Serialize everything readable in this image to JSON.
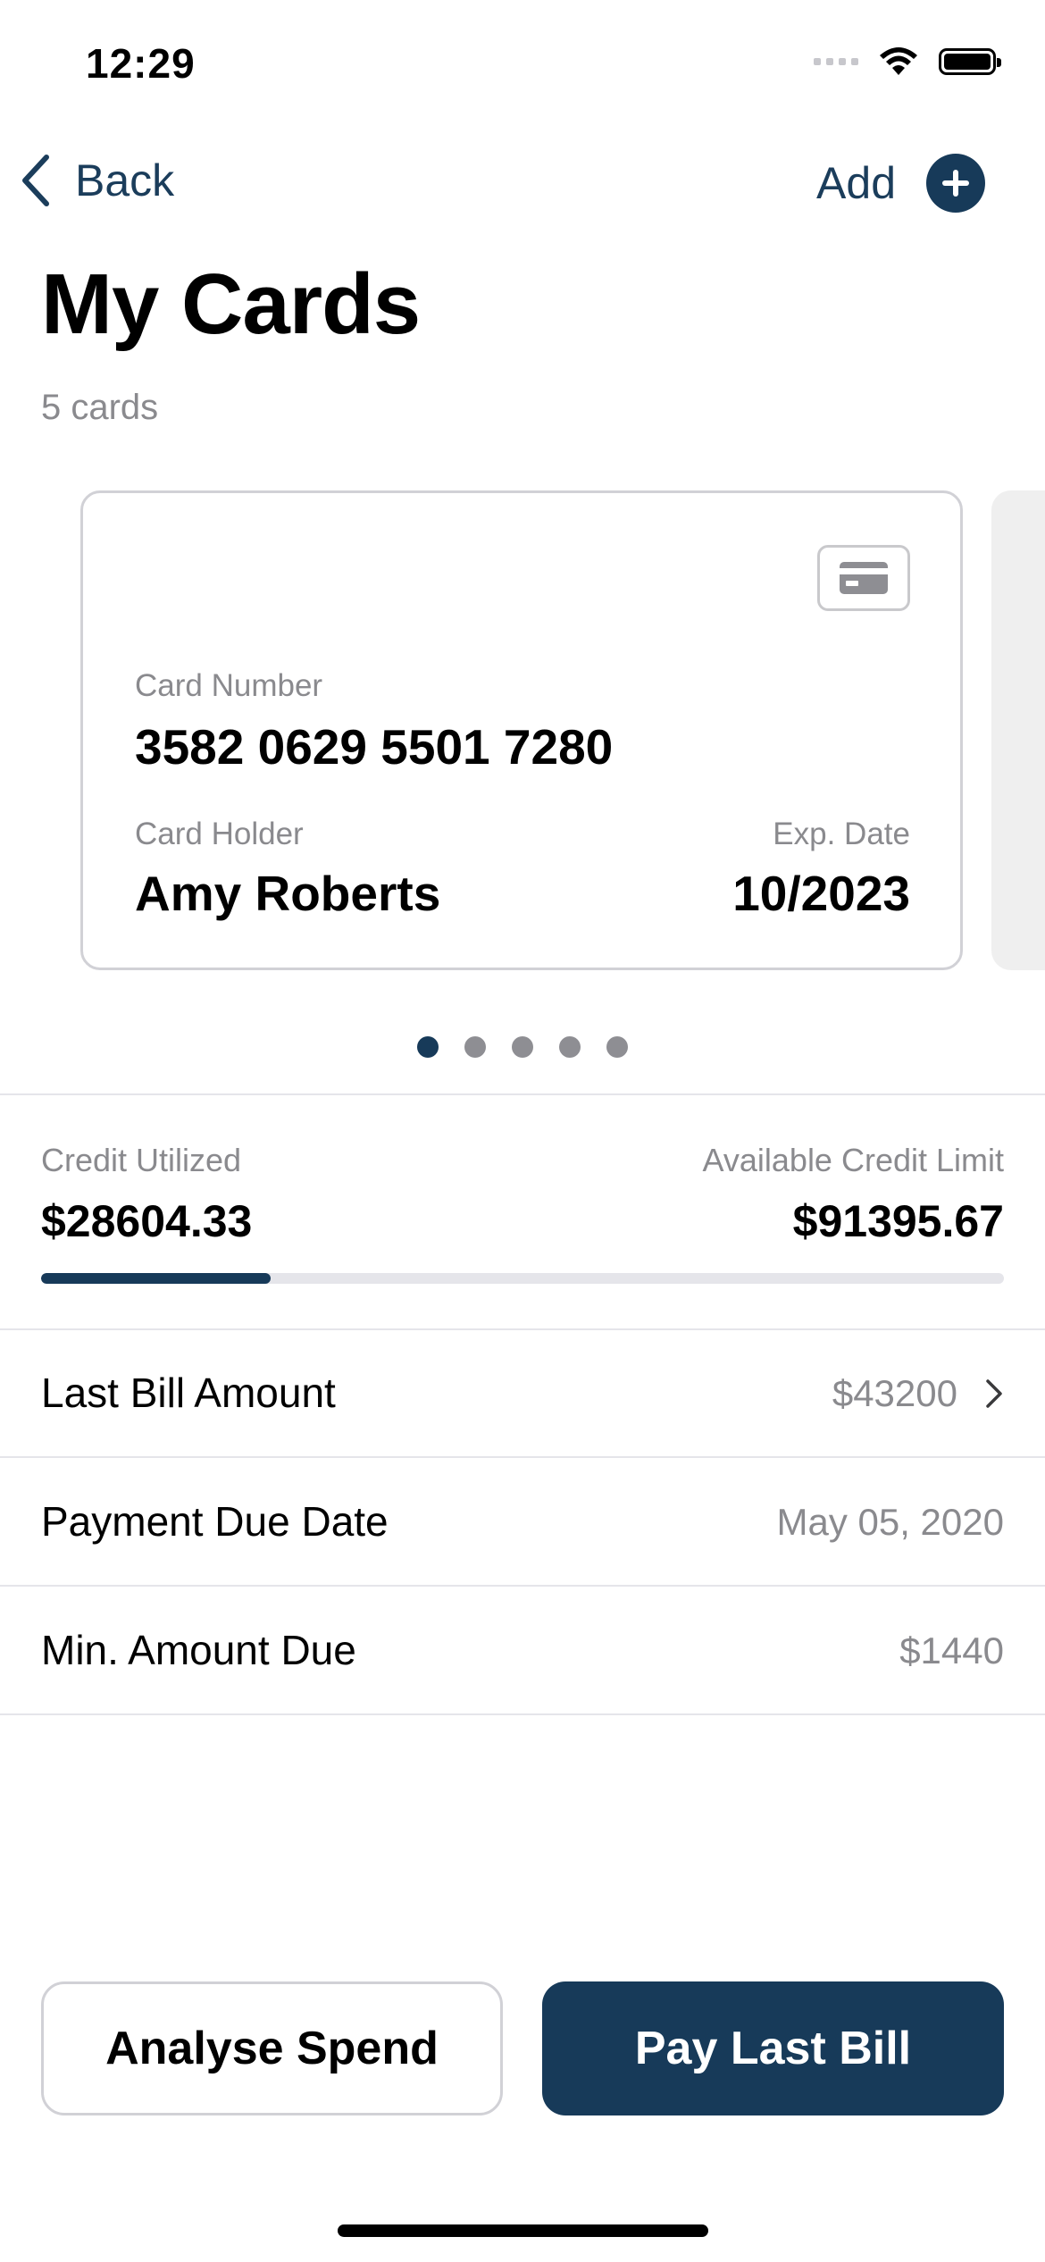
{
  "status_bar": {
    "time": "12:29"
  },
  "nav": {
    "back_label": "Back",
    "add_label": "Add"
  },
  "header": {
    "title": "My Cards",
    "subtitle": "5 cards"
  },
  "card": {
    "number_label": "Card Number",
    "number": "3582 0629 5501 7280",
    "holder_label": "Card Holder",
    "holder": "Amy Roberts",
    "exp_label": "Exp. Date",
    "exp": "10/2023"
  },
  "pagination": {
    "count": 5,
    "active_index": 0
  },
  "credit": {
    "utilized_label": "Credit Utilized",
    "utilized_value": "$28604.33",
    "available_label": "Available Credit Limit",
    "available_value": "$91395.67",
    "utilized_fraction": 0.2384
  },
  "rows": [
    {
      "label": "Last Bill Amount",
      "value": "$43200",
      "has_chevron": true
    },
    {
      "label": "Payment Due Date",
      "value": "May 05, 2020",
      "has_chevron": false
    },
    {
      "label": "Min. Amount Due",
      "value": "$1440",
      "has_chevron": false
    }
  ],
  "actions": {
    "secondary_label": "Analyse Spend",
    "primary_label": "Pay Last Bill"
  },
  "colors": {
    "accent": "#173a59",
    "secondary_text": "#8a8a8e",
    "divider": "#e5e5ea"
  }
}
